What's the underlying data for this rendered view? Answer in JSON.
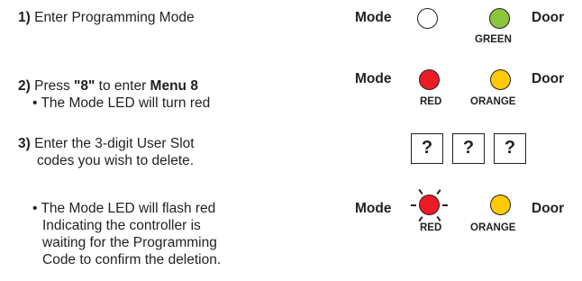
{
  "steps": {
    "s1": {
      "num": "1)",
      "text": " Enter Programming Mode"
    },
    "s2": {
      "num": "2)",
      "pre": " Press ",
      "key": "\"8\"",
      "mid": " to enter ",
      "menu": "Menu 8",
      "bullet": "• The Mode LED will turn red"
    },
    "s3": {
      "num": "3)",
      "line1": " Enter the 3-digit User Slot",
      "line2": "codes you wish to delete."
    },
    "s4": {
      "bullet": "• The Mode LED will flash red",
      "line2": "Indicating the controller is",
      "line3": "waiting for the Programming",
      "line4": "Code to confirm the deletion."
    }
  },
  "panels": {
    "p1": {
      "mode": "Mode",
      "door": "Door",
      "door_led_label": "GREEN"
    },
    "p2": {
      "mode": "Mode",
      "door": "Door",
      "mode_led_label": "RED",
      "door_led_label": "ORANGE"
    },
    "p3": {
      "boxes": [
        "?",
        "?",
        "?"
      ]
    },
    "p4": {
      "mode": "Mode",
      "door": "Door",
      "mode_led_label": "RED",
      "door_led_label": "ORANGE"
    }
  },
  "colors": {
    "green": "#8cc63f",
    "red": "#ed1c24",
    "orange": "#ffcb05",
    "off": "#ffffff",
    "ink": "#231f20"
  }
}
